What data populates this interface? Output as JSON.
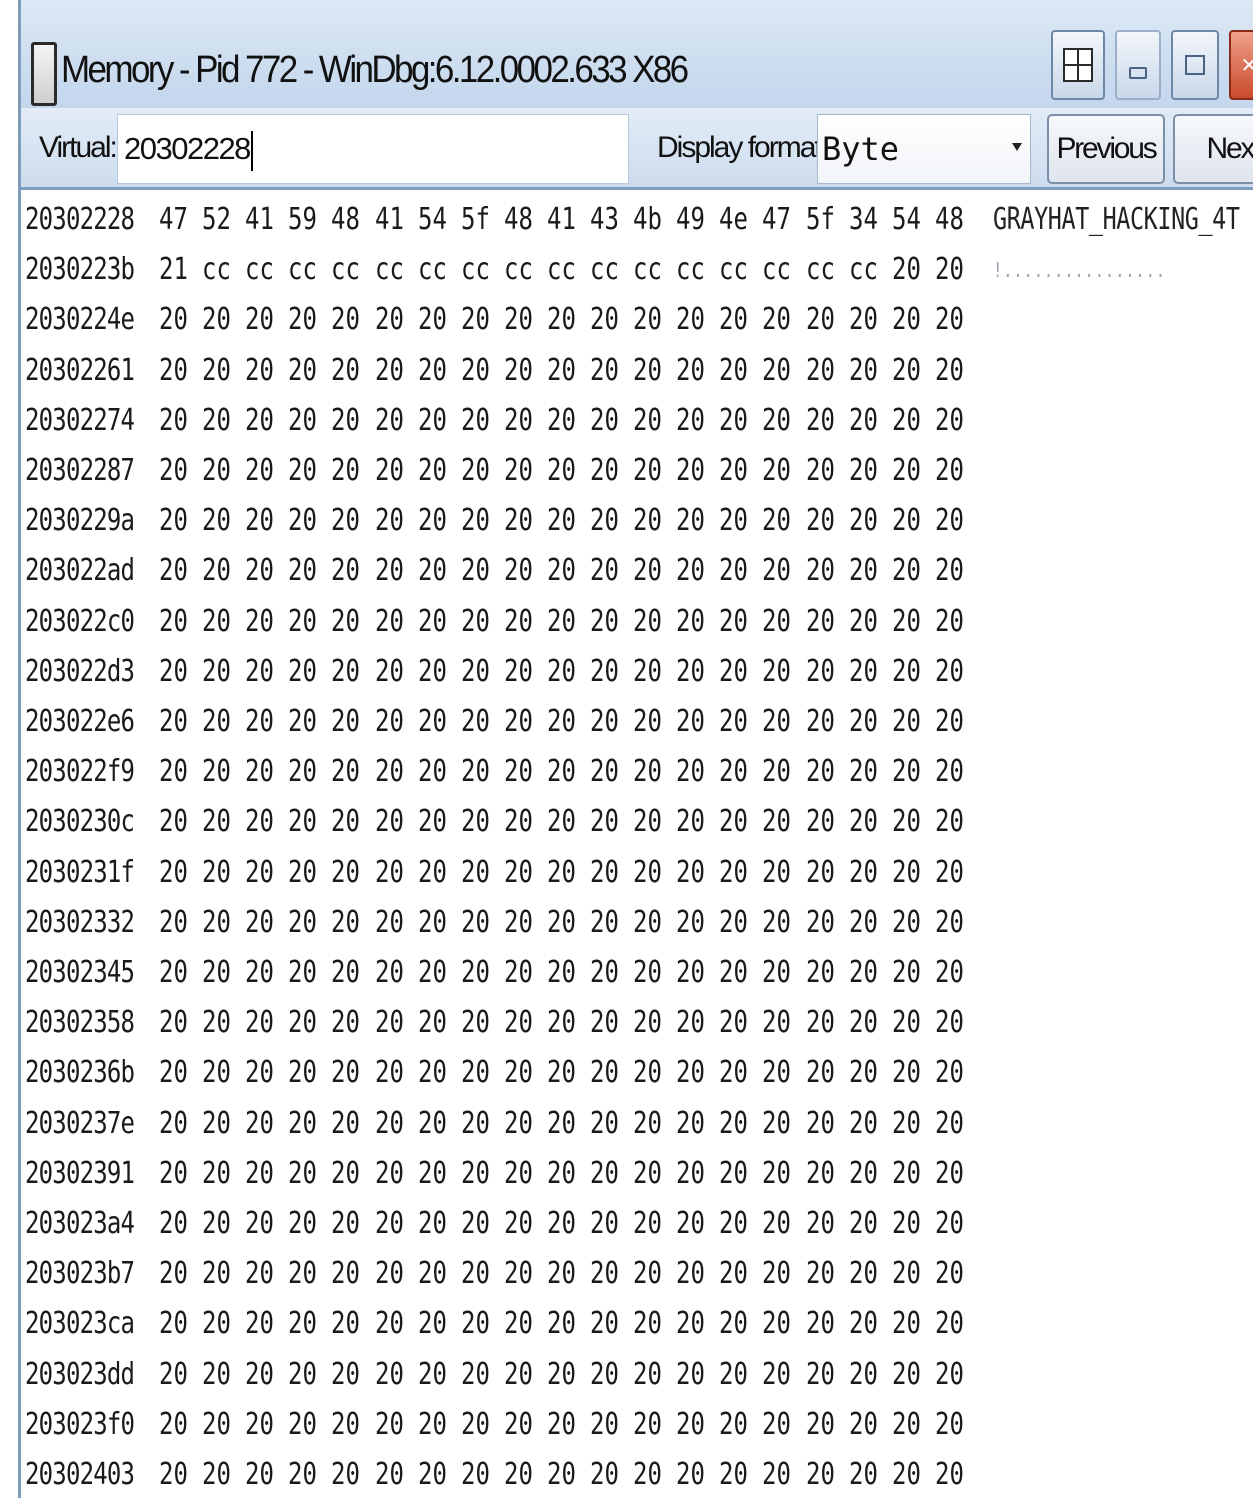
{
  "window": {
    "title": "Memory - Pid 772 - WinDbg:6.12.0002.633 X86"
  },
  "toolbar": {
    "virtual_label": "Virtual:",
    "address_value": "20302228",
    "display_format_label": "Display format:",
    "display_format_value": "Byte",
    "previous_label": "Previous",
    "next_label": "Next"
  },
  "memory": {
    "rows": [
      {
        "address": "20302228",
        "bytes": [
          "47",
          "52",
          "41",
          "59",
          "48",
          "41",
          "54",
          "5f",
          "48",
          "41",
          "43",
          "4b",
          "49",
          "4e",
          "47",
          "5f",
          "34",
          "54",
          "48"
        ],
        "ascii": "GRAYHAT_HACKING_4T"
      },
      {
        "address": "2030223b",
        "bytes": [
          "21",
          "cc",
          "cc",
          "cc",
          "cc",
          "cc",
          "cc",
          "cc",
          "cc",
          "cc",
          "cc",
          "cc",
          "cc",
          "cc",
          "cc",
          "cc",
          "cc",
          "20",
          "20"
        ],
        "ascii": "!................"
      },
      {
        "address": "2030224e",
        "bytes": [
          "20",
          "20",
          "20",
          "20",
          "20",
          "20",
          "20",
          "20",
          "20",
          "20",
          "20",
          "20",
          "20",
          "20",
          "20",
          "20",
          "20",
          "20",
          "20"
        ],
        "ascii": ""
      },
      {
        "address": "20302261",
        "bytes": [
          "20",
          "20",
          "20",
          "20",
          "20",
          "20",
          "20",
          "20",
          "20",
          "20",
          "20",
          "20",
          "20",
          "20",
          "20",
          "20",
          "20",
          "20",
          "20"
        ],
        "ascii": ""
      },
      {
        "address": "20302274",
        "bytes": [
          "20",
          "20",
          "20",
          "20",
          "20",
          "20",
          "20",
          "20",
          "20",
          "20",
          "20",
          "20",
          "20",
          "20",
          "20",
          "20",
          "20",
          "20",
          "20"
        ],
        "ascii": ""
      },
      {
        "address": "20302287",
        "bytes": [
          "20",
          "20",
          "20",
          "20",
          "20",
          "20",
          "20",
          "20",
          "20",
          "20",
          "20",
          "20",
          "20",
          "20",
          "20",
          "20",
          "20",
          "20",
          "20"
        ],
        "ascii": ""
      },
      {
        "address": "2030229a",
        "bytes": [
          "20",
          "20",
          "20",
          "20",
          "20",
          "20",
          "20",
          "20",
          "20",
          "20",
          "20",
          "20",
          "20",
          "20",
          "20",
          "20",
          "20",
          "20",
          "20"
        ],
        "ascii": ""
      },
      {
        "address": "203022ad",
        "bytes": [
          "20",
          "20",
          "20",
          "20",
          "20",
          "20",
          "20",
          "20",
          "20",
          "20",
          "20",
          "20",
          "20",
          "20",
          "20",
          "20",
          "20",
          "20",
          "20"
        ],
        "ascii": ""
      },
      {
        "address": "203022c0",
        "bytes": [
          "20",
          "20",
          "20",
          "20",
          "20",
          "20",
          "20",
          "20",
          "20",
          "20",
          "20",
          "20",
          "20",
          "20",
          "20",
          "20",
          "20",
          "20",
          "20"
        ],
        "ascii": ""
      },
      {
        "address": "203022d3",
        "bytes": [
          "20",
          "20",
          "20",
          "20",
          "20",
          "20",
          "20",
          "20",
          "20",
          "20",
          "20",
          "20",
          "20",
          "20",
          "20",
          "20",
          "20",
          "20",
          "20"
        ],
        "ascii": ""
      },
      {
        "address": "203022e6",
        "bytes": [
          "20",
          "20",
          "20",
          "20",
          "20",
          "20",
          "20",
          "20",
          "20",
          "20",
          "20",
          "20",
          "20",
          "20",
          "20",
          "20",
          "20",
          "20",
          "20"
        ],
        "ascii": ""
      },
      {
        "address": "203022f9",
        "bytes": [
          "20",
          "20",
          "20",
          "20",
          "20",
          "20",
          "20",
          "20",
          "20",
          "20",
          "20",
          "20",
          "20",
          "20",
          "20",
          "20",
          "20",
          "20",
          "20"
        ],
        "ascii": ""
      },
      {
        "address": "2030230c",
        "bytes": [
          "20",
          "20",
          "20",
          "20",
          "20",
          "20",
          "20",
          "20",
          "20",
          "20",
          "20",
          "20",
          "20",
          "20",
          "20",
          "20",
          "20",
          "20",
          "20"
        ],
        "ascii": ""
      },
      {
        "address": "2030231f",
        "bytes": [
          "20",
          "20",
          "20",
          "20",
          "20",
          "20",
          "20",
          "20",
          "20",
          "20",
          "20",
          "20",
          "20",
          "20",
          "20",
          "20",
          "20",
          "20",
          "20"
        ],
        "ascii": ""
      },
      {
        "address": "20302332",
        "bytes": [
          "20",
          "20",
          "20",
          "20",
          "20",
          "20",
          "20",
          "20",
          "20",
          "20",
          "20",
          "20",
          "20",
          "20",
          "20",
          "20",
          "20",
          "20",
          "20"
        ],
        "ascii": ""
      },
      {
        "address": "20302345",
        "bytes": [
          "20",
          "20",
          "20",
          "20",
          "20",
          "20",
          "20",
          "20",
          "20",
          "20",
          "20",
          "20",
          "20",
          "20",
          "20",
          "20",
          "20",
          "20",
          "20"
        ],
        "ascii": ""
      },
      {
        "address": "20302358",
        "bytes": [
          "20",
          "20",
          "20",
          "20",
          "20",
          "20",
          "20",
          "20",
          "20",
          "20",
          "20",
          "20",
          "20",
          "20",
          "20",
          "20",
          "20",
          "20",
          "20"
        ],
        "ascii": ""
      },
      {
        "address": "2030236b",
        "bytes": [
          "20",
          "20",
          "20",
          "20",
          "20",
          "20",
          "20",
          "20",
          "20",
          "20",
          "20",
          "20",
          "20",
          "20",
          "20",
          "20",
          "20",
          "20",
          "20"
        ],
        "ascii": ""
      },
      {
        "address": "2030237e",
        "bytes": [
          "20",
          "20",
          "20",
          "20",
          "20",
          "20",
          "20",
          "20",
          "20",
          "20",
          "20",
          "20",
          "20",
          "20",
          "20",
          "20",
          "20",
          "20",
          "20"
        ],
        "ascii": ""
      },
      {
        "address": "20302391",
        "bytes": [
          "20",
          "20",
          "20",
          "20",
          "20",
          "20",
          "20",
          "20",
          "20",
          "20",
          "20",
          "20",
          "20",
          "20",
          "20",
          "20",
          "20",
          "20",
          "20"
        ],
        "ascii": ""
      },
      {
        "address": "203023a4",
        "bytes": [
          "20",
          "20",
          "20",
          "20",
          "20",
          "20",
          "20",
          "20",
          "20",
          "20",
          "20",
          "20",
          "20",
          "20",
          "20",
          "20",
          "20",
          "20",
          "20"
        ],
        "ascii": ""
      },
      {
        "address": "203023b7",
        "bytes": [
          "20",
          "20",
          "20",
          "20",
          "20",
          "20",
          "20",
          "20",
          "20",
          "20",
          "20",
          "20",
          "20",
          "20",
          "20",
          "20",
          "20",
          "20",
          "20"
        ],
        "ascii": ""
      },
      {
        "address": "203023ca",
        "bytes": [
          "20",
          "20",
          "20",
          "20",
          "20",
          "20",
          "20",
          "20",
          "20",
          "20",
          "20",
          "20",
          "20",
          "20",
          "20",
          "20",
          "20",
          "20",
          "20"
        ],
        "ascii": ""
      },
      {
        "address": "203023dd",
        "bytes": [
          "20",
          "20",
          "20",
          "20",
          "20",
          "20",
          "20",
          "20",
          "20",
          "20",
          "20",
          "20",
          "20",
          "20",
          "20",
          "20",
          "20",
          "20",
          "20"
        ],
        "ascii": ""
      },
      {
        "address": "203023f0",
        "bytes": [
          "20",
          "20",
          "20",
          "20",
          "20",
          "20",
          "20",
          "20",
          "20",
          "20",
          "20",
          "20",
          "20",
          "20",
          "20",
          "20",
          "20",
          "20",
          "20"
        ],
        "ascii": ""
      },
      {
        "address": "20302403",
        "bytes": [
          "20",
          "20",
          "20",
          "20",
          "20",
          "20",
          "20",
          "20",
          "20",
          "20",
          "20",
          "20",
          "20",
          "20",
          "20",
          "20",
          "20",
          "20",
          "20"
        ],
        "ascii": ""
      }
    ]
  }
}
